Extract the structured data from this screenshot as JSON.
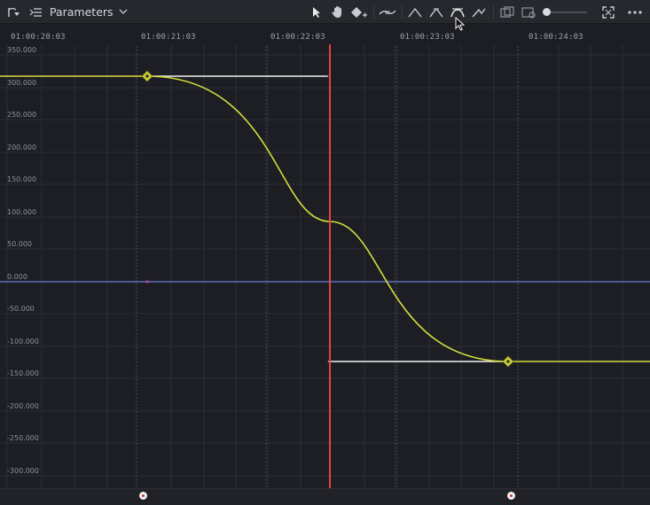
{
  "toolbar": {
    "parameters_label": "Parameters",
    "icons": [
      "keyframe-filter-icon",
      "list-icon",
      "chevron-down-icon",
      "select-arrow-icon",
      "hand-pan-icon",
      "add-keyframe-icon",
      "smooth-curve-icon",
      "linear-interp-icon",
      "ease-in-icon",
      "ease-in-out-icon",
      "ease-out-icon",
      "copy-curve-icon",
      "paste-curve-icon",
      "zoom-slider-icon",
      "fit-view-icon",
      "more-options-icon"
    ],
    "zoom_level": 0.0
  },
  "timeline": {
    "labels": [
      "01:00:20:03",
      "01:00:21:03",
      "01:00:22:03",
      "01:00:23:03",
      "01:00:24:03"
    ]
  },
  "y_axis": {
    "labels": [
      "350.000",
      "300.000",
      "250.000",
      "200.000",
      "150.000",
      "100.000",
      "50.000",
      "0.000",
      "-50.000",
      "-100.000",
      "-150.000",
      "-200.000",
      "-250.000",
      "-300.000"
    ]
  },
  "colors": {
    "curve": "#d6dc3a",
    "playhead": "#e5453f",
    "zero_line": "#4f5a99",
    "handle": "#f2f2f2",
    "grid": "#2c2f36",
    "keyframe_marker": "#f2f2f2"
  },
  "curve": {
    "start_value": 317,
    "end_value": -122,
    "start_time": "01:00:21:03",
    "end_time": "01:00:23:18"
  },
  "playhead": {
    "time": "01:00:22:18"
  }
}
